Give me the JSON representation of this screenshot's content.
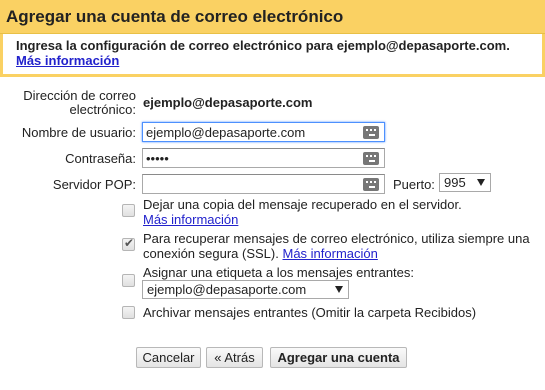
{
  "dialog": {
    "title": "Agregar una cuenta de correo electrónico",
    "intro": "Ingresa la configuración de correo electrónico para ejemplo@depasaporte.com.",
    "more_info": "Más información"
  },
  "form": {
    "email_label": "Dirección de correo electrónico:",
    "email_value": "ejemplo@depasaporte.com",
    "username_label": "Nombre de usuario:",
    "username_value": "ejemplo@depasaporte.com",
    "password_label": "Contraseña:",
    "password_value": "•••••",
    "pop_label": "Servidor POP:",
    "pop_value": "",
    "port_label": "Puerto:",
    "port_value": "995"
  },
  "options": {
    "leave_copy": "Dejar una copia del mensaje recuperado en el servidor.",
    "leave_copy_more": "Más información",
    "ssl_line1": "Para recuperar mensajes de correo electrónico, utiliza siempre una",
    "ssl_line2": "conexión segura (SSL).",
    "ssl_more": "Más información",
    "label_incoming": "Asignar una etiqueta a los mensajes entrantes:",
    "label_select_value": "ejemplo@depasaporte.com",
    "archive": "Archivar mensajes entrantes (Omitir la carpeta Recibidos)"
  },
  "buttons": {
    "cancel": "Cancelar",
    "back": "« Atrás",
    "add": "Agregar una cuenta"
  },
  "state": {
    "leave_copy_checked": false,
    "ssl_checked": true,
    "label_checked": false,
    "archive_checked": false
  },
  "colors": {
    "title_bar": "#fad163",
    "link": "#2222cc",
    "focus": "#4d90fe"
  }
}
